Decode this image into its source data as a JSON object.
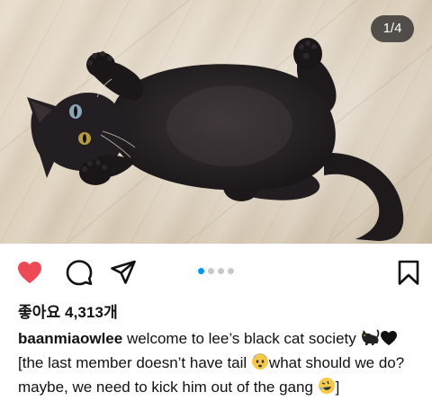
{
  "post": {
    "image_counter": "1/4",
    "likes_text": "좋아요 4,313개",
    "carousel": {
      "count": 4,
      "active_index": 0
    },
    "username": "baanmiaowlee",
    "caption_line1": " welcome to lee’s black cat society ",
    "caption_rest": "[the last member doesn’t have tail ",
    "caption_line3": "what should we do? maybe, we need to kick him out of the gang ",
    "caption_end": "]",
    "emojis": [
      "black-cat-emoji",
      "black-heart-emoji",
      "anxious-face-emoji",
      "rolling-laughing-emoji"
    ]
  },
  "colors": {
    "like_red": "#ed4956",
    "active_dot": "#0095f6",
    "inactive_dot": "#c7c7c7"
  },
  "icons": [
    "heart-icon",
    "comment-icon",
    "share-icon",
    "bookmark-icon"
  ]
}
